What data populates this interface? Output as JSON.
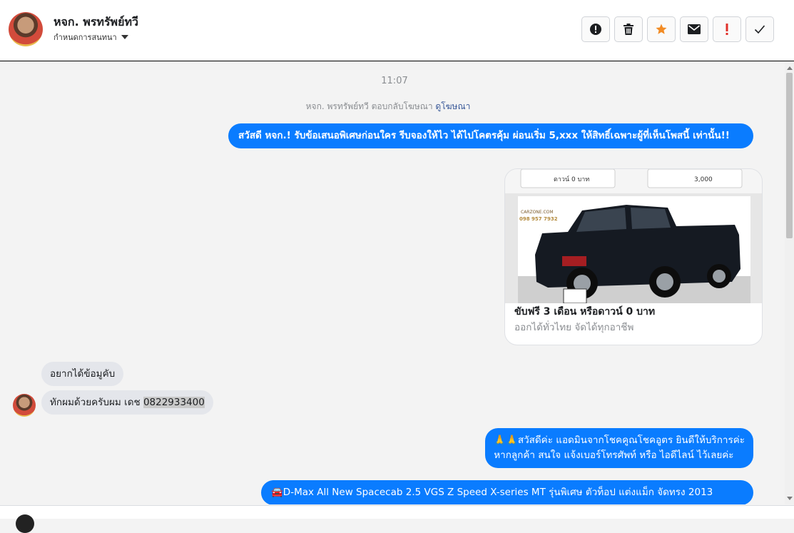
{
  "header": {
    "contact_name": "หจก. พรทรัพย์ทวี",
    "assign_label": "กำหนดการสนทนา",
    "actions": [
      {
        "name": "mark-spam",
        "icon": "alert-circle-icon"
      },
      {
        "name": "delete",
        "icon": "trash-icon"
      },
      {
        "name": "star",
        "icon": "star-icon",
        "color": "#f28b24"
      },
      {
        "name": "mark-unread",
        "icon": "envelope-icon"
      },
      {
        "name": "follow-up",
        "icon": "exclamation-icon",
        "color": "#e0312b"
      },
      {
        "name": "mark-done",
        "icon": "checkmark-icon"
      }
    ]
  },
  "chat": {
    "time": "11:07",
    "ad_reply_text": "หจก. พรทรัพย์ทวี ตอบกลับโฆษณา",
    "ad_reply_link": "ดูโฆษณา",
    "messages": {
      "out_1": "สวัสดี หจก.! รับข้อเสนอพิเศษก่อนใคร รีบจองให้ไว ได้ไปโคตรคุ้ม ผ่อนเริ่ม 5,xxx  ให้สิทธิ์เฉพาะผู้ที่เห็นโพสนี้ เท่านั้น!!",
      "card": {
        "banner_left": "ดาวน์ 0 บาท",
        "banner_right": "3,000",
        "logo_text": "CARZONE.COM",
        "logo_phone": "098 957 7932",
        "title": "ขับฟรี 3 เดือน หรือดาวน์ 0 บาท",
        "subtitle": "ออกได้ทั่วไทย จัดได้ทุกอาชีพ"
      },
      "in_1": "อยากได้ข้อมูคับ",
      "in_2_prefix": "ทักผมด้วยครับผม เดช ",
      "in_2_phone": "0822933400",
      "out_2_line1": "🙏🙏สวัสดีค่ะ แอดมินจากโชคคูณโชคอูตร ยินดีให้บริการค่ะ",
      "out_2_line2": "หากลูกค้า สนใจ แจ้งเบอร์โทรศัพท์ หรือ ไอดีไลน์  ไว้เลยค่ะ",
      "out_3": "🚘D-Max All New Spacecab 2.5 VGS Z Speed X-series MT รุ่นพิเศษ ตัวท็อป แต่งแม็ก จัดทรง 2013"
    }
  },
  "colors": {
    "outgoing_bubble": "#0a7cff",
    "incoming_bubble": "#e4e6eb",
    "link": "#385898"
  }
}
